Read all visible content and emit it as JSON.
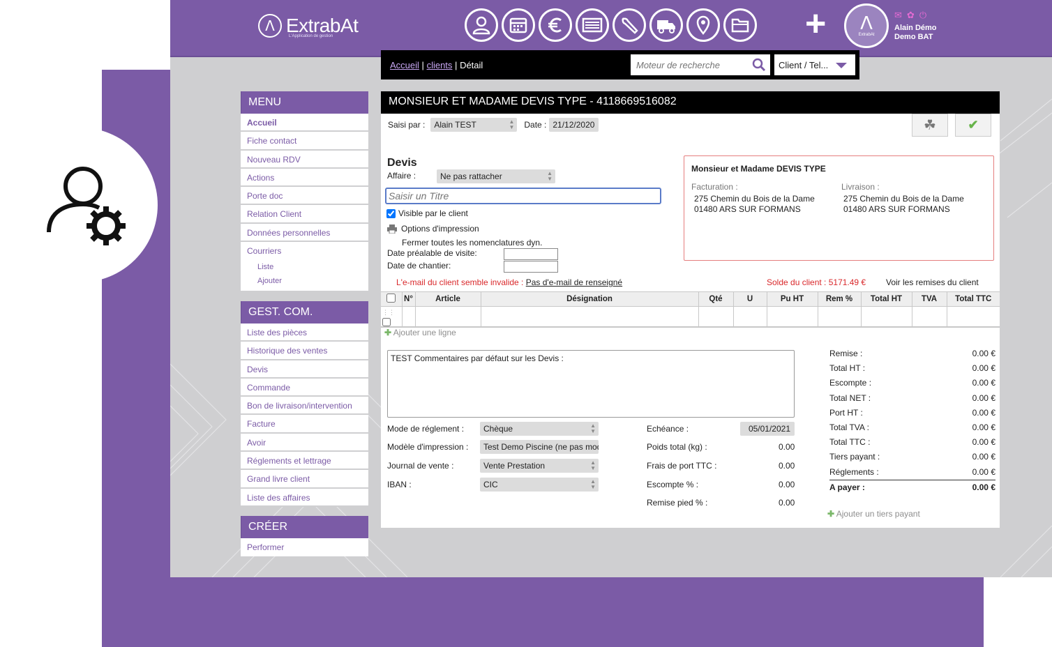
{
  "brand": {
    "name": "ExtrabAt",
    "tagline": "L'Application de gestion",
    "logo_glyph": "Λ"
  },
  "header": {
    "nav_icons": [
      "user-icon",
      "calendar-icon",
      "euro-icon",
      "table-icon",
      "wrench-icon",
      "truck-icon",
      "map-pin-icon",
      "folder-icon"
    ],
    "plus": "+",
    "user": {
      "line1": "Alain Démo",
      "line2": "Demo BAT",
      "logo_glyph": "Λ",
      "logo_sub": "ExtrabAt"
    }
  },
  "breadcrumb": {
    "home": "Accueil",
    "clients": "clients",
    "current": "Détail",
    "sep": "|"
  },
  "search": {
    "placeholder": "Moteur de recherche",
    "type_value": "Client / Tel..."
  },
  "menu": {
    "title": "MENU",
    "items": [
      "Accueil",
      "Fiche contact",
      "Nouveau RDV",
      "Actions",
      "Porte doc",
      "Relation Client",
      "Données personnelles",
      "Courriers"
    ],
    "sub": [
      "Liste",
      "Ajouter"
    ]
  },
  "gestcom": {
    "title": "GEST. COM.",
    "items": [
      "Liste des pièces",
      "Historique des ventes",
      "Devis",
      "Commande",
      "Bon de livraison/intervention",
      "Facture",
      "Avoir",
      "Réglements et lettrage",
      "Grand livre client",
      "Liste des affaires"
    ]
  },
  "creer": {
    "title": "CRÉER",
    "items": [
      "Performer"
    ]
  },
  "doc": {
    "title": "MONSIEUR ET MADAME DEVIS TYPE - 4118669516082",
    "saisi_label": "Saisi par :",
    "saisi_value": "Alain TEST",
    "date_label": "Date :",
    "date_value": "21/12/2020",
    "devis_heading": "Devis",
    "affaire_label": "Affaire :",
    "affaire_value": "Ne pas rattacher",
    "titre_placeholder": "Saisir un Titre",
    "visible_label": "Visible par le client",
    "options_label": "Options d'impression",
    "fermer_label": "Fermer toutes les nomenclatures dyn.",
    "date_visite_label": "Date préalable de visite:",
    "date_chantier_label": "Date de chantier:",
    "email_warning": "L'e-mail du client semble invalide :",
    "email_link": "Pas d'e-mail de renseigné",
    "solde": "Solde du client : 5171.49 €",
    "remises_link": "Voir les remises du client"
  },
  "client": {
    "name": "Monsieur et Madame DEVIS TYPE",
    "facturation_label": "Facturation :",
    "facturation_line1": "275 Chemin du Bois de la Dame",
    "facturation_line2": "01480 ARS SUR FORMANS",
    "livraison_label": "Livraison :",
    "livraison_line1": "275 Chemin du Bois de la Dame",
    "livraison_line2": "01480 ARS SUR FORMANS"
  },
  "table": {
    "headers": [
      "N°",
      "Article",
      "Désignation",
      "Qté",
      "U",
      "Pu HT",
      "Rem %",
      "Total HT",
      "TVA",
      "Total TTC"
    ],
    "add_line": "Ajouter une ligne"
  },
  "comment": "TEST Commentaires par défaut sur les Devis :",
  "form": {
    "mode_label": "Mode de réglement :",
    "mode_value": "Chèque",
    "modele_label": "Modèle d'impression :",
    "modele_value": "Test Demo Piscine (ne pas modi",
    "journal_label": "Journal de vente :",
    "journal_value": "Vente Prestation",
    "iban_label": "IBAN :",
    "iban_value": "CIC",
    "echeance_label": "Echéance :",
    "echeance_value": "05/01/2021",
    "poids_label": "Poids total (kg) :",
    "poids_value": "0.00",
    "frais_label": "Frais de port TTC :",
    "frais_value": "0.00",
    "escompte_label": "Escompte % :",
    "escompte_value": "0.00",
    "remise_label": "Remise pied % :",
    "remise_value": "0.00"
  },
  "totals": [
    {
      "label": "Remise :",
      "value": "0.00 €"
    },
    {
      "label": "Total HT :",
      "value": "0.00 €"
    },
    {
      "label": "Escompte :",
      "value": "0.00 €"
    },
    {
      "label": "Total NET :",
      "value": "0.00 €"
    },
    {
      "label": "Port HT :",
      "value": "0.00 €"
    },
    {
      "label": "Total TVA :",
      "value": "0.00 €"
    },
    {
      "label": "Total TTC :",
      "value": "0.00 €"
    },
    {
      "label": "Tiers payant :",
      "value": "0.00 €"
    },
    {
      "label": "Réglements :",
      "value": "0.00 €"
    }
  ],
  "total_pay": {
    "label": "A payer :",
    "value": "0.00 €"
  },
  "add_tiers": "Ajouter un tiers payant",
  "colors": {
    "brand": "#7b5ba6",
    "warning": "#d9282b",
    "accent_link": "#c9a8f4"
  }
}
